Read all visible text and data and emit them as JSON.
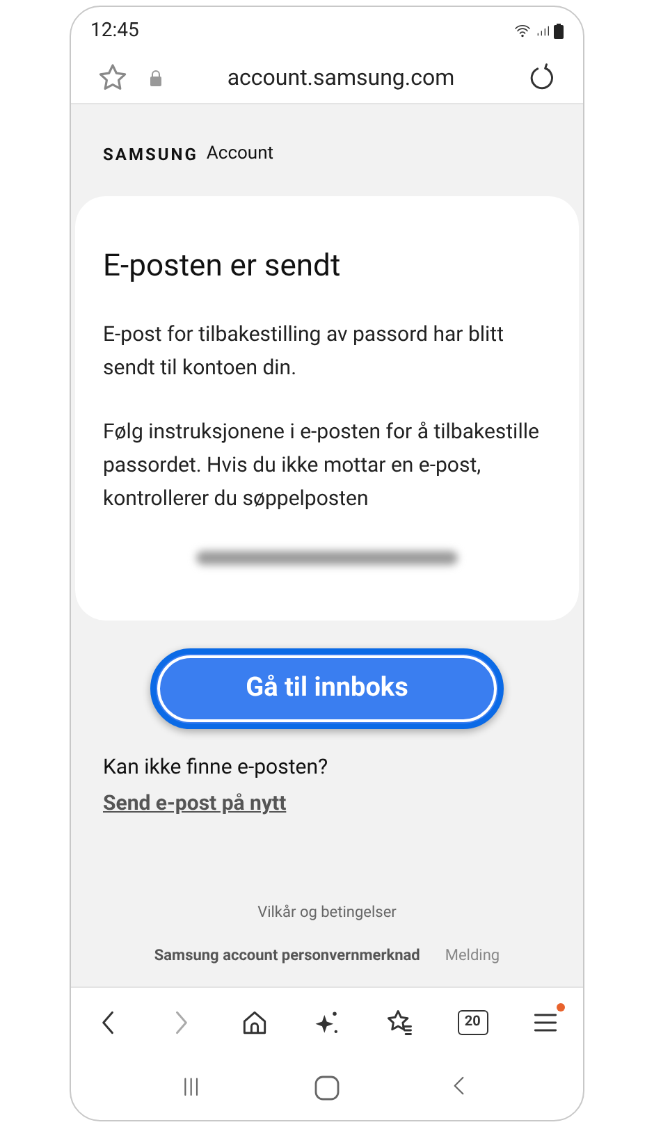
{
  "status_bar": {
    "time": "12:45"
  },
  "address_bar": {
    "url": "account.samsung.com"
  },
  "brand": {
    "logo": "SAMSUNG",
    "product": "Account"
  },
  "card": {
    "title": "E-posten er sendt",
    "paragraphs": [
      "E-post for tilbakestilling av passord har blitt sendt til kontoen din.",
      "Følg instruksjonene i e-posten for å tilbakestille passordet. Hvis du ikke mottar en e-post, kontrollerer du søppelposten"
    ],
    "email_blurred": true
  },
  "primary_button": {
    "label": "Gå til innboks"
  },
  "help": {
    "question": "Kan ikke finne e-posten?",
    "link": "Send e-post på nytt"
  },
  "footer": {
    "terms": "Vilkår og betingelser",
    "links": [
      "Samsung account personvernmerknad",
      "Melding"
    ]
  },
  "toolbar": {
    "tab_count": "20",
    "menu_badge": true
  }
}
